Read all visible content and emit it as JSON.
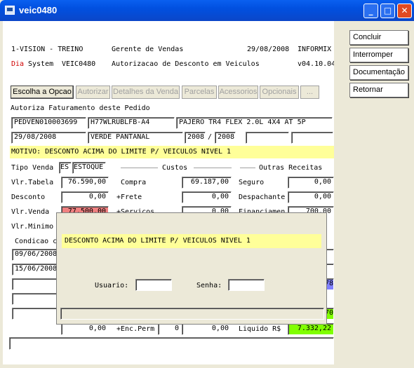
{
  "window": {
    "title": "veic0480"
  },
  "header": {
    "company": "1-VISION - TREINO",
    "role": "Gerente de Vendas",
    "date": "29/08/2008",
    "db": "INFORMIX",
    "dia": "Dia",
    "system_label": "System",
    "program": "VEIC0480",
    "description": "Autorizacao de Desconto em Veiculos",
    "version": "v04.10.04"
  },
  "tabs": [
    "Escolha a Opcao",
    "Autorizar",
    "Detalhes da Venda",
    "Parcelas",
    "Acessorios",
    "Opcionais",
    "..."
  ],
  "side_buttons": [
    "Concluir",
    "Interromper",
    "Documentação",
    "Retornar"
  ],
  "page_title": "Autoriza Faturamento deste Pedido",
  "row1": {
    "pedido": "PEDVEN010003699",
    "chassi": "H77WLRUBLFB-A4",
    "model": "PAJERO TR4 FLEX 2.0L 4X4 AT 5P"
  },
  "row2": {
    "date": "29/08/2008",
    "color": "VERDE PANTANAL",
    "year_fab": "2008",
    "sep": "/",
    "year_mod": "2008"
  },
  "motivo": "MOTIVO: DESCONTO ACIMA DO LIMITE P/ VEICULOS NIVEL 1",
  "tipo_venda": {
    "label": "Tipo Venda",
    "code": "ES",
    "value": "ESTOQUE"
  },
  "sections": {
    "custos": "Custos",
    "outras": "Outras Receitas"
  },
  "left_labels": {
    "tabela": "Vlr.Tabela",
    "desconto": "Desconto",
    "venda": "Vlr.Venda",
    "minimo": "Vlr.Minimo",
    "condicao": "Condicao c"
  },
  "left_values": {
    "tabela": "76.590,00",
    "desconto": "0,00",
    "venda": "77.500,00"
  },
  "mid_labels": {
    "compra": "Compra",
    "frete": "+Frete",
    "servicos": "+Servicos"
  },
  "mid_values": {
    "compra": "69.187,00",
    "frete": "0,00",
    "servicos": "0,00"
  },
  "right_labels": {
    "seguro": "Seguro",
    "despachante": "Despachante",
    "financiamento": "Financiamen"
  },
  "right_values": {
    "seguro": "0,00",
    "despachante": "0,00",
    "financiamento": "700,00"
  },
  "parcel_dates": [
    "09/06/2008",
    "15/06/2008"
  ],
  "partial_values": {
    "blue": "78",
    "green": "70"
  },
  "bottom": {
    "value1": "0,00",
    "enc_label": "+Enc.Perm",
    "enc_count": "0",
    "enc_value": "0,00",
    "sep": "/",
    "liquido_label": "Liquido R$",
    "liquido_value": "7.332,22"
  },
  "dialog": {
    "message": "DESCONTO ACIMA DO LIMITE P/ VEICULOS NIVEL 1",
    "usuario_label": "Usuario:",
    "senha_label": "Senha:",
    "usuario_value": "",
    "senha_value": ""
  },
  "colors": {
    "title_bar": "#0b56e0",
    "highlight_yellow": "#ffff99",
    "warn_red": "#f08080",
    "blue": "#8080ff",
    "green": "#80ff00"
  }
}
